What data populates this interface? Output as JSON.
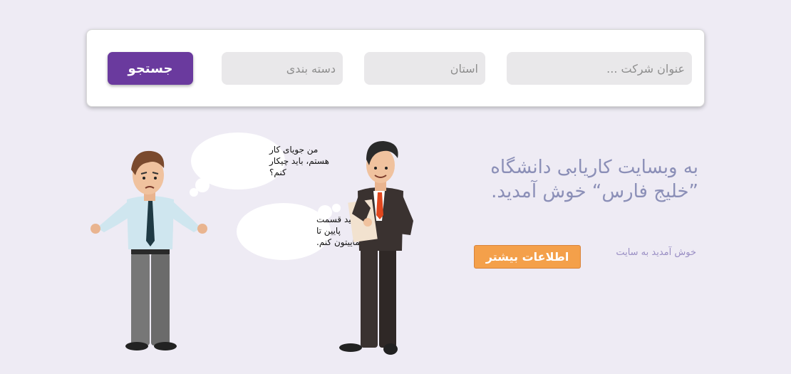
{
  "search": {
    "company_placeholder": "عنوان شرکت ...",
    "province_placeholder": "استان",
    "category_placeholder": "دسته بندی",
    "button_label": "جستجو"
  },
  "hero": {
    "title_line1": "به وبسایت کاریابی دانشگاه",
    "title_line2": "”خلیج فارس“ خوش آمدید.",
    "more_button": "اطلاعات بیشتر",
    "welcome_link": "خوش آمدید به سایت"
  },
  "illustration": {
    "jobseeker_bubble": [
      "من جویای کار",
      "هستم، باید چیکار",
      "کنم؟"
    ],
    "guide_bubble": [
      "بیایید قسمت",
      "پایین تا",
      "راهنماییتون کنم."
    ]
  },
  "colors": {
    "background": "#eeebf4",
    "search_button": "#6a3a9e",
    "accent_orange": "#f4a04a",
    "title_text": "#8b8fb7"
  }
}
